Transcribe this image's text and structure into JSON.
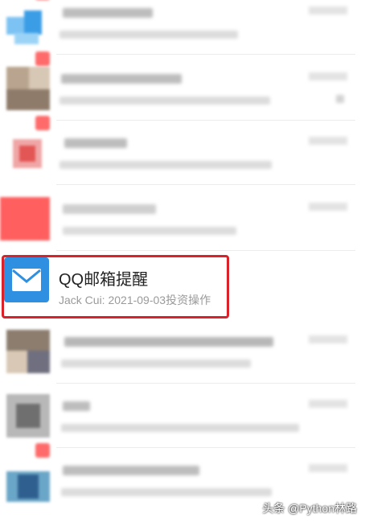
{
  "conversation_list": {
    "highlighted_item": {
      "title": "QQ邮箱提醒",
      "preview": "Jack Cui: 2021-09-03投资操作",
      "icon": "mail-envelope-icon",
      "icon_color": "#2f8fe0",
      "highlight_color": "#d9222a"
    }
  },
  "watermark": "头条 @Python林路"
}
